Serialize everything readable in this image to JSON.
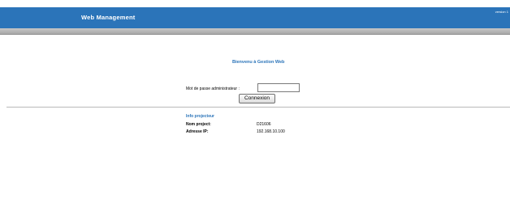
{
  "header": {
    "title": "Web Management",
    "version": "version 1"
  },
  "main": {
    "welcome": "Bienvenu à Gestion Web",
    "login": {
      "password_label": "Mot de passe administrateur :",
      "password_value": "",
      "button_label": "Connexion"
    },
    "info": {
      "title": "Info projecteur",
      "rows": [
        {
          "label": "Nom project:",
          "value": "D21606"
        },
        {
          "label": "Adresse IP:",
          "value": "192.168.10.100"
        }
      ]
    }
  },
  "colors": {
    "brand_blue": "#2b74b9",
    "subbar_gray": "#b8b8b8"
  }
}
